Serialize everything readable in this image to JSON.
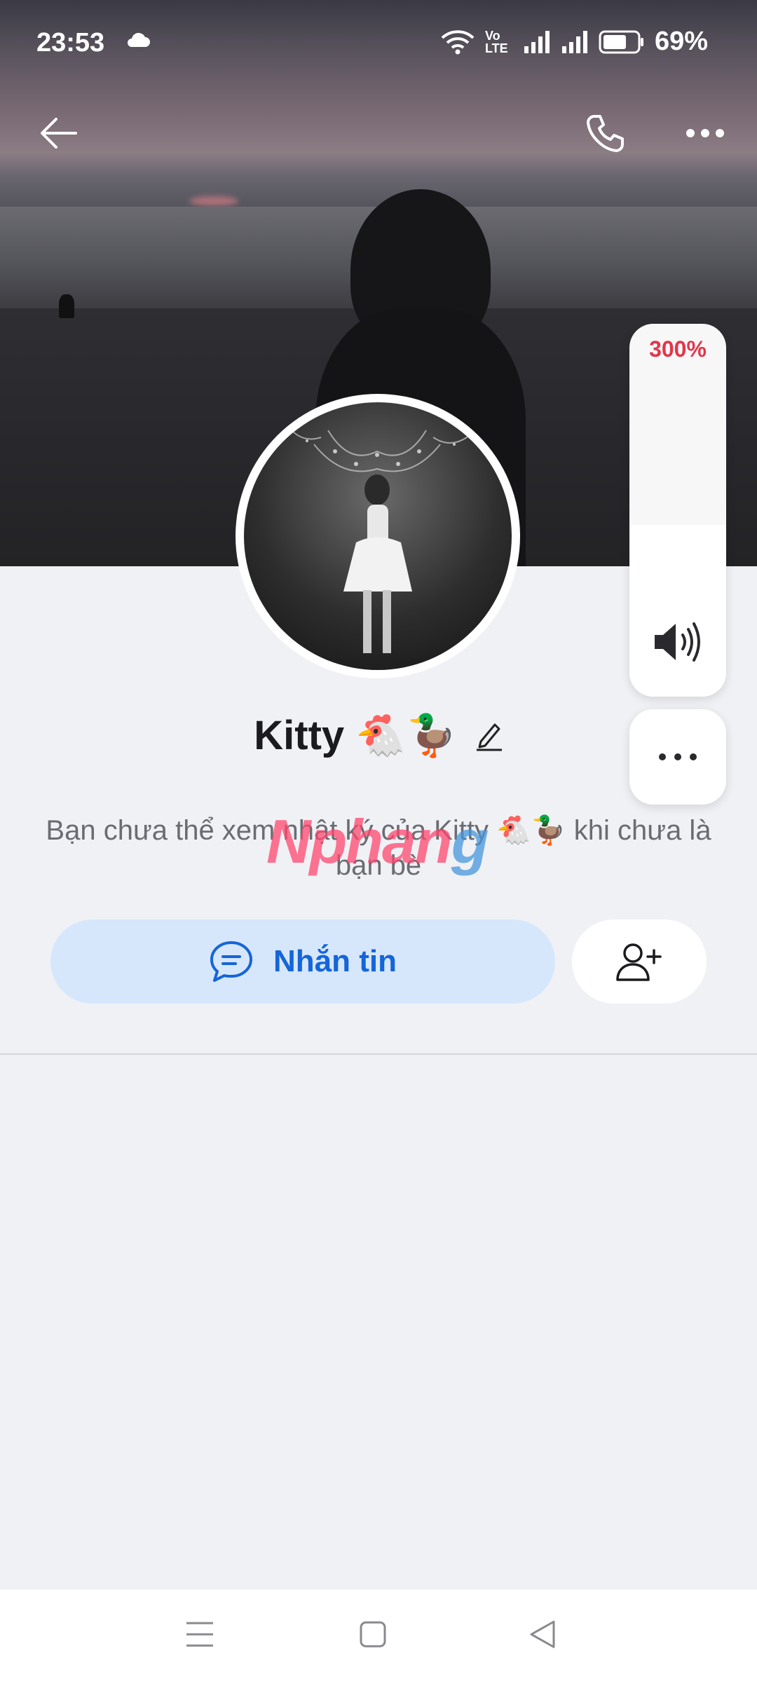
{
  "status_bar": {
    "time": "23:53",
    "volte_label": "Vo LTE",
    "battery_percent": "69%"
  },
  "profile": {
    "name": "Kitty 🐔🦆",
    "notice": "Bạn chưa thể xem nhật ký của Kitty 🐔🦆 khi chưa là bạn bè"
  },
  "actions": {
    "message_label": "Nhắn tin"
  },
  "volume_overlay": {
    "percent_label": "300%",
    "level_fraction": 0.46
  },
  "watermark": {
    "part1": "Nphan",
    "part2": "g"
  },
  "colors": {
    "accent": "#1565d8",
    "message_button_bg": "#d6e7fc",
    "volume_percent": "#e2364a",
    "background": "#f0f1f5"
  }
}
